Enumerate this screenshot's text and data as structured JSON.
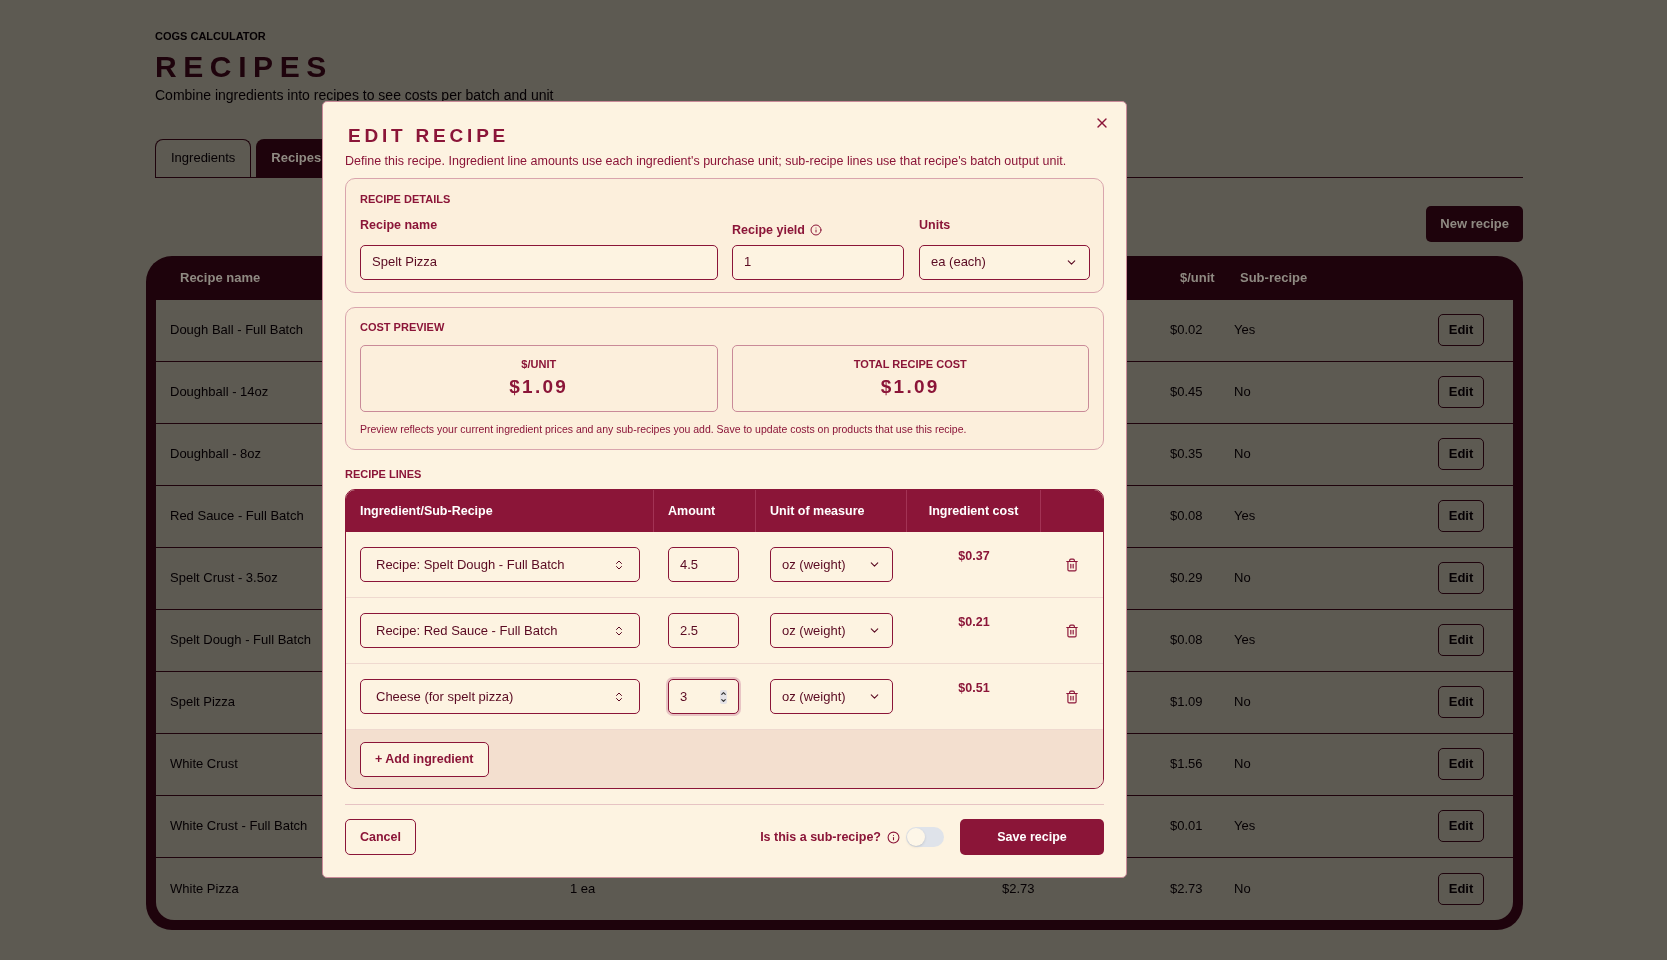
{
  "page": {
    "eyebrow": "COGS CALCULATOR",
    "title": "RECIPES",
    "subtitle": "Combine ingredients into recipes to see costs per batch and unit"
  },
  "tabs": [
    {
      "label": "Ingredients",
      "selected": false
    },
    {
      "label": "Recipes",
      "selected": true
    }
  ],
  "new_button": "New recipe",
  "table": {
    "columns": [
      "Recipe name",
      "$/unit",
      "Sub-recipe"
    ],
    "rows": [
      {
        "name": "Dough Ball - Full Batch",
        "unit_cost": "$0.02",
        "sub_recipe": "Yes",
        "action": "Edit"
      },
      {
        "name": "Doughball - 14oz",
        "unit_cost": "$0.45",
        "sub_recipe": "No",
        "action": "Edit"
      },
      {
        "name": "Doughball - 8oz",
        "unit_cost": "$0.35",
        "sub_recipe": "No",
        "action": "Edit"
      },
      {
        "name": "Red Sauce - Full Batch",
        "unit_cost": "$0.08",
        "sub_recipe": "Yes",
        "action": "Edit"
      },
      {
        "name": "Spelt Crust - 3.5oz",
        "unit_cost": "$0.29",
        "sub_recipe": "No",
        "action": "Edit"
      },
      {
        "name": "Spelt Dough - Full Batch",
        "unit_cost": "$0.08",
        "sub_recipe": "Yes",
        "action": "Edit"
      },
      {
        "name": "Spelt Pizza",
        "unit_cost": "$1.09",
        "sub_recipe": "No",
        "action": "Edit"
      },
      {
        "name": "White Crust",
        "unit_cost": "$1.56",
        "sub_recipe": "No",
        "action": "Edit"
      },
      {
        "name": "White Crust - Full Batch",
        "unit_cost": "$0.01",
        "sub_recipe": "Yes",
        "action": "Edit"
      },
      {
        "name": "White Pizza",
        "column_2": "1 ea",
        "column_3": "$2.73",
        "unit_cost": "$2.73",
        "sub_recipe": "No",
        "action": "Edit"
      }
    ]
  },
  "modal": {
    "title": "EDIT RECIPE",
    "description": "Define this recipe. Ingredient line amounts use each ingredient's purchase unit; sub-recipe lines use that recipe's batch output unit.",
    "details": {
      "heading": "RECIPE DETAILS",
      "name_label": "Recipe name",
      "name_value": "Spelt Pizza",
      "yield_label": "Recipe yield",
      "yield_value": "1",
      "units_label": "Units",
      "units_value": "ea (each)"
    },
    "preview": {
      "heading": "COST PREVIEW",
      "cards": [
        {
          "label": "$/UNIT",
          "value": "$1.09"
        },
        {
          "label": "TOTAL RECIPE COST",
          "value": "$1.09"
        }
      ],
      "note": "Preview reflects your current ingredient prices and any sub-recipes you add. Save to update costs on products that use this recipe."
    },
    "lines": {
      "heading": "RECIPE LINES",
      "columns": [
        "Ingredient/Sub-Recipe",
        "Amount",
        "Unit of measure",
        "Ingredient cost"
      ],
      "rows": [
        {
          "ingredient": "Recipe: Spelt Dough - Full Batch",
          "amount": "4.5",
          "unit": "oz (weight)",
          "cost": "$0.37",
          "focused": false
        },
        {
          "ingredient": "Recipe: Red Sauce - Full Batch",
          "amount": "2.5",
          "unit": "oz (weight)",
          "cost": "$0.21",
          "focused": false
        },
        {
          "ingredient": "Cheese (for spelt pizza)",
          "amount": "3",
          "unit": "oz (weight)",
          "cost": "$0.51",
          "focused": true
        }
      ],
      "add_button": "+ Add ingredient"
    },
    "footer": {
      "cancel": "Cancel",
      "sub_recipe_label": "Is this a sub-recipe?",
      "sub_recipe_on": false,
      "save": "Save recipe"
    }
  }
}
